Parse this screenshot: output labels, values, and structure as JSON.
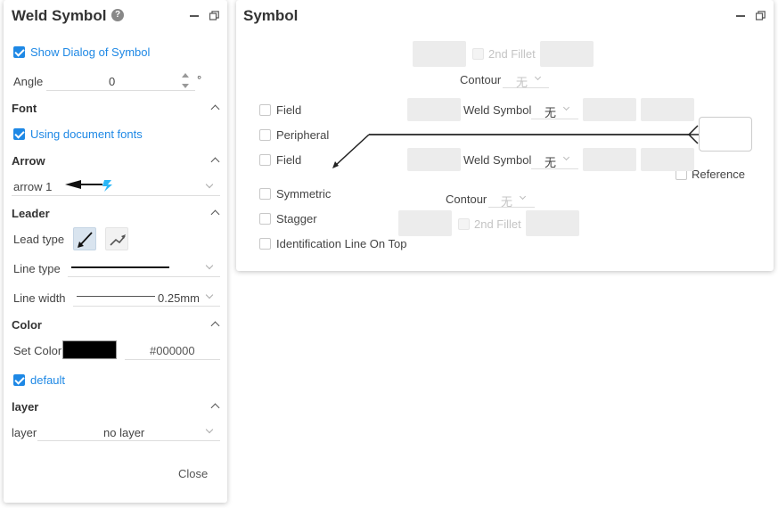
{
  "weld_panel": {
    "title": "Weld Symbol",
    "help_glyph": "?",
    "show_dialog_label": "Show Dialog of Symbol",
    "angle_label": "Angle",
    "angle_value": "0",
    "angle_unit": "°",
    "font_section": "Font",
    "using_doc_fonts_label": "Using document fonts",
    "arrow_section": "Arrow",
    "arrow_value": "arrow 1",
    "leader_section": "Leader",
    "lead_type_label": "Lead type",
    "line_type_label": "Line type",
    "line_width_label": "Line width",
    "line_width_value": "0.25mm",
    "color_section": "Color",
    "set_color_label": "Set Color",
    "color_hex": "#000000",
    "default_label": "default",
    "layer_section": "layer",
    "layer_label": "layer",
    "layer_value": "no layer",
    "close_label": "Close"
  },
  "symbol_panel": {
    "title": "Symbol",
    "top_second_fillet": "2nd Fillet",
    "top_contour_label": "Contour",
    "top_contour_value": "无",
    "field_top_label": "Field",
    "peripheral_label": "Peripheral",
    "field_bottom_label": "Field",
    "symmetric_label": "Symmetric",
    "stagger_label": "Stagger",
    "id_line_label": "Identification Line On Top",
    "upper_weld_symbol_label": "Weld Symbol",
    "upper_weld_symbol_value": "无",
    "lower_weld_symbol_label": "Weld Symbol",
    "lower_weld_symbol_value": "无",
    "reference_label": "Reference",
    "bottom_contour_label": "Contour",
    "bottom_contour_value": "无",
    "bottom_second_fillet": "2nd Fillet"
  },
  "colors": {
    "accent": "#1e88e5",
    "swatch": "#000000",
    "lightning": "#29b6f6"
  }
}
